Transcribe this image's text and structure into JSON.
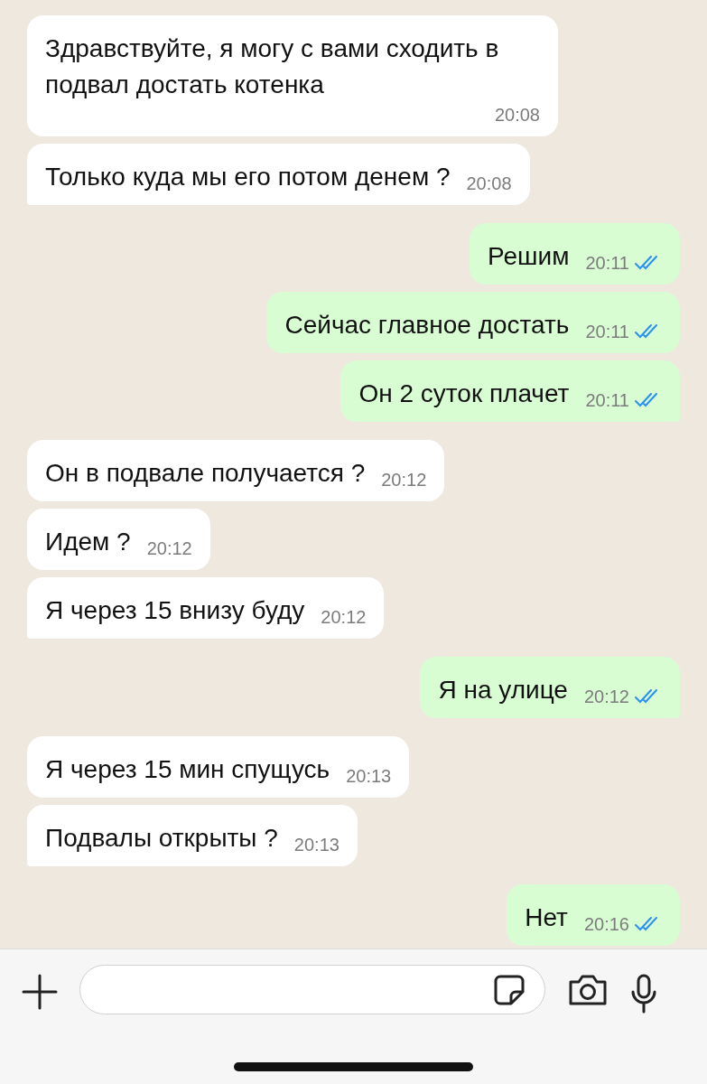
{
  "messages": [
    {
      "kind": "in",
      "text": "Здравствуйте, я могу с вами сходить в подвал достать котенка",
      "time": "20:08",
      "tail": false
    },
    {
      "kind": "in",
      "text": "Только куда мы его потом денем ?",
      "time": "20:08",
      "tail": true
    },
    {
      "kind": "out",
      "text": "Решим",
      "time": "20:11",
      "read": true,
      "tail": false
    },
    {
      "kind": "out",
      "text": "Сейчас главное достать",
      "time": "20:11",
      "read": true,
      "tail": false
    },
    {
      "kind": "out",
      "text": "Он 2 суток плачет",
      "time": "20:11",
      "read": true,
      "tail": true
    },
    {
      "kind": "in",
      "text": "Он в подвале получается ?",
      "time": "20:12",
      "tail": false
    },
    {
      "kind": "in",
      "text": "Идем ?",
      "time": "20:12",
      "tail": false
    },
    {
      "kind": "in",
      "text": "Я через 15 внизу буду",
      "time": "20:12",
      "tail": true
    },
    {
      "kind": "out",
      "text": "Я на улице",
      "time": "20:12",
      "read": true,
      "tail": true
    },
    {
      "kind": "in",
      "text": "Я через 15 мин спущусь",
      "time": "20:13",
      "tail": false
    },
    {
      "kind": "in",
      "text": "Подвалы открыты ?",
      "time": "20:13",
      "tail": true
    },
    {
      "kind": "out",
      "text": "Нет",
      "time": "20:16",
      "read": true,
      "tail": false
    }
  ]
}
